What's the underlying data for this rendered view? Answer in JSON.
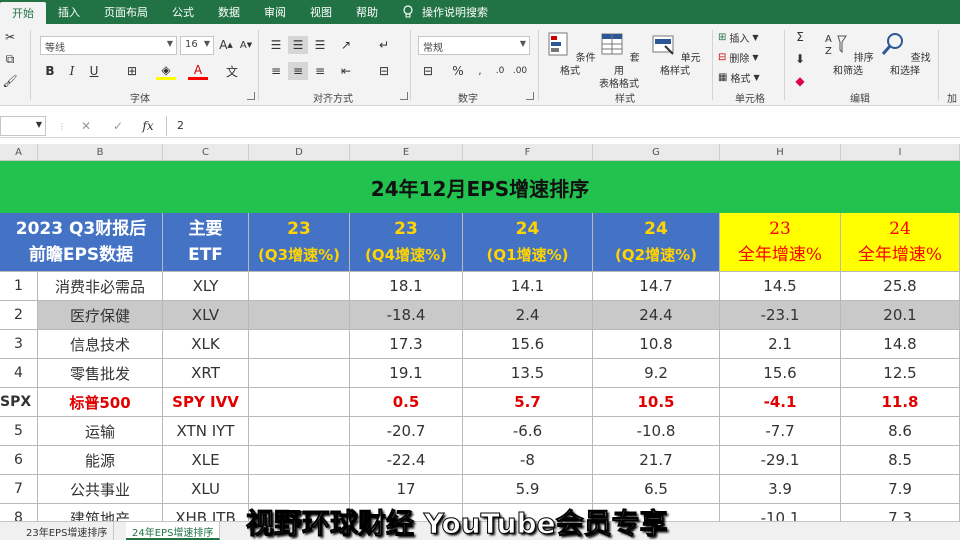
{
  "ribbon_tabs": [
    "开始",
    "插入",
    "页面布局",
    "公式",
    "数据",
    "审阅",
    "视图",
    "帮助",
    "操作说明搜索"
  ],
  "font": {
    "name": "等线",
    "size": "16",
    "group_label": "字体"
  },
  "alignment": {
    "group_label": "对齐方式"
  },
  "number": {
    "format": "常规",
    "group_label": "数字"
  },
  "styles": {
    "conditional": "条件格式",
    "table_format_1": "套用",
    "table_format_2": "表格格式",
    "cell_styles": "单元格样式",
    "group_label": "样式"
  },
  "cells": {
    "insert": "插入",
    "delete": "删除",
    "format": "格式",
    "group_label": "单元格"
  },
  "editing": {
    "sort_filter": "排序和筛选",
    "find_select": "查找和选择",
    "group_label": "编辑",
    "add": "加"
  },
  "formula_bar": {
    "fx": "fx",
    "value": "2"
  },
  "columns": [
    "A",
    "B",
    "C",
    "D",
    "E",
    "F",
    "G",
    "H",
    "I"
  ],
  "sheet": {
    "title": "24年12月EPS增速排序",
    "headers": {
      "a_line1": "2023 Q3财报后",
      "a_line2": "前瞻EPS数据",
      "c_line1": "主要",
      "c_line2": "ETF",
      "d_line1": "23",
      "d_line2": "(Q3增速%)",
      "e_line1": "23",
      "e_line2": "(Q4增速%)",
      "f_line1": "24",
      "f_line2": "(Q1增速%)",
      "g_line1": "24",
      "g_line2": "(Q2增速%)",
      "h_line1": "23",
      "h_line2": "全年增速%",
      "i_line1": "24",
      "i_line2": "全年增速%"
    },
    "rows": [
      {
        "a": "1",
        "b": "消费非必需品",
        "c": "XLY",
        "d": "",
        "e": "18.1",
        "f": "14.1",
        "g": "14.7",
        "h": "14.5",
        "i": "25.8"
      },
      {
        "a": "2",
        "b": "医疗保健",
        "c": "XLV",
        "d": "",
        "e": "-18.4",
        "f": "2.4",
        "g": "24.4",
        "h": "-23.1",
        "i": "20.1"
      },
      {
        "a": "3",
        "b": "信息技术",
        "c": "XLK",
        "d": "",
        "e": "17.3",
        "f": "15.6",
        "g": "10.8",
        "h": "2.1",
        "i": "14.8"
      },
      {
        "a": "4",
        "b": "零售批发",
        "c": "XRT",
        "d": "",
        "e": "19.1",
        "f": "13.5",
        "g": "9.2",
        "h": "15.6",
        "i": "12.5"
      },
      {
        "a": "SPX",
        "b": "标普500",
        "c": "SPY IVV",
        "d": "",
        "e": "0.5",
        "f": "5.7",
        "g": "10.5",
        "h": "-4.1",
        "i": "11.8"
      },
      {
        "a": "5",
        "b": "运输",
        "c": "XTN  IYT",
        "d": "",
        "e": "-20.7",
        "f": "-6.6",
        "g": "-10.8",
        "h": "-7.7",
        "i": "8.6"
      },
      {
        "a": "6",
        "b": "能源",
        "c": "XLE",
        "d": "",
        "e": "-22.4",
        "f": "-8",
        "g": "21.7",
        "h": "-29.1",
        "i": "8.5"
      },
      {
        "a": "7",
        "b": "公共事业",
        "c": "XLU",
        "d": "",
        "e": "17",
        "f": "5.9",
        "g": "6.5",
        "h": "3.9",
        "i": "7.9"
      },
      {
        "a": "8",
        "b": "建筑地产",
        "c": "XHB  ITB",
        "d": "",
        "e": "",
        "f": "",
        "g": "",
        "h": "-10.1",
        "i": "7.3"
      }
    ]
  },
  "sheet_tabs": [
    "23年EPS增速排序",
    "24年EPS增速排序"
  ],
  "watermark": "视野环球财经 YouTube会员专享",
  "colors": {
    "ribbon": "#217346",
    "title_bg": "#22c24f",
    "header_blue": "#4472c4",
    "header_yellow": "#ffff00",
    "red": "#ff0000"
  }
}
